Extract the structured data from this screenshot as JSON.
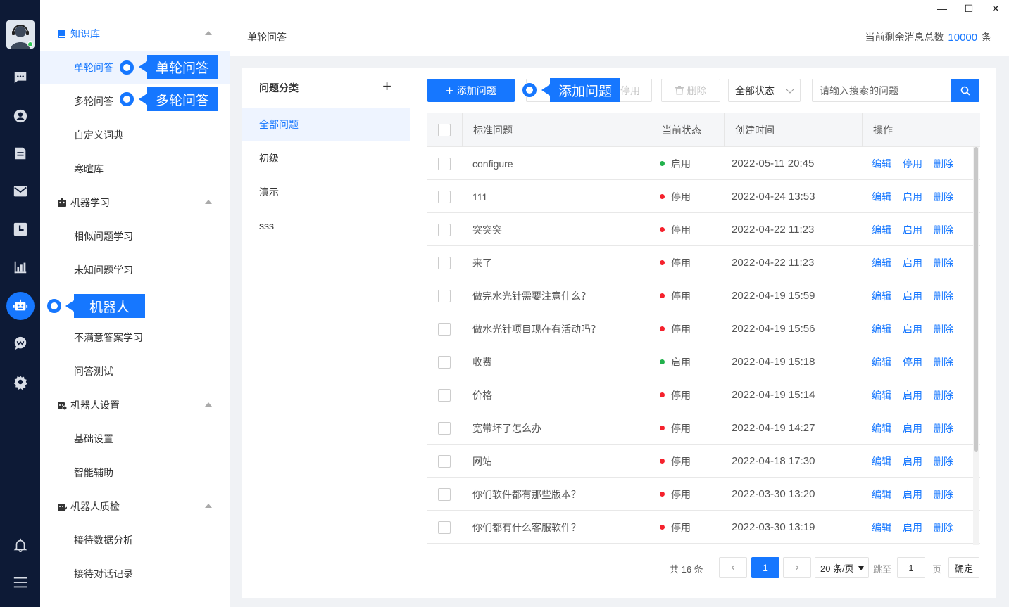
{
  "window": {
    "minimize": "—",
    "maximize": "☐",
    "close": "✕"
  },
  "rail": {
    "icons": [
      "avatar",
      "chat-icon",
      "user-icon",
      "document-icon",
      "mail-icon",
      "clock-icon",
      "bar-chart-icon",
      "robot-icon",
      "wechat-icon",
      "gear-icon",
      "bell-icon",
      "menu-icon"
    ],
    "active": "robot-icon",
    "online_color": "#34c759"
  },
  "sidebar": {
    "groups": [
      {
        "label": "知识库",
        "items": [
          "单轮问答",
          "多轮问答",
          "自定义词典",
          "寒暄库"
        ]
      },
      {
        "label": "机器学习",
        "items": [
          "相似问题学习",
          "未知问题学习",
          "不满意答案学习",
          "问答测试"
        ]
      },
      {
        "label": "机器人设置",
        "items": [
          "基础设置",
          "智能辅助"
        ]
      },
      {
        "label": "机器人质检",
        "items": [
          "接待数据分析",
          "接待对话记录"
        ]
      }
    ],
    "active_item": "单轮问答"
  },
  "callouts": {
    "single": "单轮问答",
    "multi": "多轮问答",
    "robot": "机器人",
    "add": "添加问题"
  },
  "topbar": {
    "title": "单轮问答",
    "remain_prefix": "当前剩余消息总数",
    "remain_count": "10000",
    "remain_unit": "条"
  },
  "categories": {
    "title": "问题分类",
    "add": "+",
    "items": [
      "全部问题",
      "初级",
      "演示",
      "sss"
    ],
    "active": "全部问题"
  },
  "toolbar": {
    "add_label": "添加问题",
    "disable_label": "停用",
    "delete_label": "删除",
    "status_select": "全部状态",
    "search_placeholder": "请输入搜索的问题"
  },
  "table": {
    "headers": [
      "标准问题",
      "当前状态",
      "创建时间",
      "操作"
    ],
    "rows": [
      {
        "q": "configure",
        "status": "启用",
        "time": "2022-05-11 20:45",
        "ops": [
          "编辑",
          "停用",
          "删除"
        ]
      },
      {
        "q": "111",
        "status": "停用",
        "time": "2022-04-24 13:53",
        "ops": [
          "编辑",
          "启用",
          "删除"
        ]
      },
      {
        "q": "突突突",
        "status": "停用",
        "time": "2022-04-22 11:23",
        "ops": [
          "编辑",
          "启用",
          "删除"
        ]
      },
      {
        "q": "来了",
        "status": "停用",
        "time": "2022-04-22 11:23",
        "ops": [
          "编辑",
          "启用",
          "删除"
        ]
      },
      {
        "q": "做完水光针需要注意什么？",
        "status": "停用",
        "time": "2022-04-19 15:59",
        "ops": [
          "编辑",
          "启用",
          "删除"
        ]
      },
      {
        "q": "做水光针项目现在有活动吗？",
        "status": "停用",
        "time": "2022-04-19 15:56",
        "ops": [
          "编辑",
          "启用",
          "删除"
        ]
      },
      {
        "q": "收费",
        "status": "启用",
        "time": "2022-04-19 15:18",
        "ops": [
          "编辑",
          "停用",
          "删除"
        ]
      },
      {
        "q": "价格",
        "status": "停用",
        "time": "2022-04-19 15:14",
        "ops": [
          "编辑",
          "启用",
          "删除"
        ]
      },
      {
        "q": "宽带坏了怎么办",
        "status": "停用",
        "time": "2022-04-19 14:27",
        "ops": [
          "编辑",
          "启用",
          "删除"
        ]
      },
      {
        "q": "网站",
        "status": "停用",
        "time": "2022-04-18 17:30",
        "ops": [
          "编辑",
          "启用",
          "删除"
        ]
      },
      {
        "q": "你们软件都有那些版本？",
        "status": "停用",
        "time": "2022-03-30 13:20",
        "ops": [
          "编辑",
          "启用",
          "删除"
        ]
      },
      {
        "q": "你们都有什么客服软件？",
        "status": "停用",
        "time": "2022-03-30 13:19",
        "ops": [
          "编辑",
          "启用",
          "删除"
        ]
      }
    ],
    "status_colors": {
      "启用": "#22b14c",
      "停用": "#f5222d"
    }
  },
  "pagination": {
    "total": "共 16 条",
    "prev": "‹",
    "current": "1",
    "next": "›",
    "page_size": "20 条/页",
    "jump_label": "跳至",
    "jump_value": "1",
    "page_unit": "页",
    "confirm": "确定"
  },
  "colors": {
    "primary": "#1677ff",
    "rail_bg": "#0d1a36"
  }
}
